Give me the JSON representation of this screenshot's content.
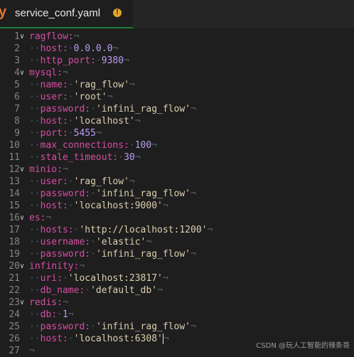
{
  "tab": {
    "file_icon": "y",
    "filename": "service_conf.yaml",
    "warning_icon": "!",
    "accent": "#1f7a3c"
  },
  "editor": {
    "lines": [
      {
        "num": "1",
        "fold": "down",
        "indent": "",
        "key": "ragflow",
        "value": "",
        "vtype": ""
      },
      {
        "num": "2",
        "fold": "",
        "indent": "··",
        "key": "host",
        "value": "0.0.0.0",
        "vtype": "n"
      },
      {
        "num": "3",
        "fold": "",
        "indent": "··",
        "key": "http_port",
        "value": "9380",
        "vtype": "n"
      },
      {
        "num": "4",
        "fold": "down",
        "indent": "",
        "key": "mysql",
        "value": "",
        "vtype": ""
      },
      {
        "num": "5",
        "fold": "",
        "indent": "··",
        "key": "name",
        "value": "'rag_flow'",
        "vtype": "s"
      },
      {
        "num": "6",
        "fold": "",
        "indent": "··",
        "key": "user",
        "value": "'root'",
        "vtype": "s"
      },
      {
        "num": "7",
        "fold": "",
        "indent": "··",
        "key": "password",
        "value": "'infini_rag_flow'",
        "vtype": "s"
      },
      {
        "num": "8",
        "fold": "",
        "indent": "··",
        "key": "host",
        "value": "'localhost'",
        "vtype": "s"
      },
      {
        "num": "9",
        "fold": "",
        "indent": "··",
        "key": "port",
        "value": "5455",
        "vtype": "n"
      },
      {
        "num": "10",
        "fold": "",
        "indent": "··",
        "key": "max_connections",
        "value": "100",
        "vtype": "n"
      },
      {
        "num": "11",
        "fold": "",
        "indent": "··",
        "key": "stale_timeout",
        "value": "30",
        "vtype": "n"
      },
      {
        "num": "12",
        "fold": "down",
        "indent": "",
        "key": "minio",
        "value": "",
        "vtype": ""
      },
      {
        "num": "13",
        "fold": "",
        "indent": "··",
        "key": "user",
        "value": "'rag_flow'",
        "vtype": "s"
      },
      {
        "num": "14",
        "fold": "",
        "indent": "··",
        "key": "password",
        "value": "'infini_rag_flow'",
        "vtype": "s"
      },
      {
        "num": "15",
        "fold": "",
        "indent": "··",
        "key": "host",
        "value": "'localhost:9000'",
        "vtype": "s"
      },
      {
        "num": "16",
        "fold": "down",
        "indent": "",
        "key": "es",
        "value": "",
        "vtype": ""
      },
      {
        "num": "17",
        "fold": "",
        "indent": "··",
        "key": "hosts",
        "value": "'http://localhost:1200'",
        "vtype": "s"
      },
      {
        "num": "18",
        "fold": "",
        "indent": "··",
        "key": "username",
        "value": "'elastic'",
        "vtype": "s"
      },
      {
        "num": "19",
        "fold": "",
        "indent": "··",
        "key": "password",
        "value": "'infini_rag_flow'",
        "vtype": "s"
      },
      {
        "num": "20",
        "fold": "down",
        "indent": "",
        "key": "infinity",
        "value": "",
        "vtype": ""
      },
      {
        "num": "21",
        "fold": "",
        "indent": "··",
        "key": "uri",
        "value": "'localhost:23817'",
        "vtype": "s"
      },
      {
        "num": "22",
        "fold": "",
        "indent": "··",
        "key": "db_name",
        "value": "'default_db'",
        "vtype": "s"
      },
      {
        "num": "23",
        "fold": "down",
        "indent": "",
        "key": "redis",
        "value": "",
        "vtype": ""
      },
      {
        "num": "24",
        "fold": "",
        "indent": "··",
        "key": "db",
        "value": "1",
        "vtype": "n"
      },
      {
        "num": "25",
        "fold": "",
        "indent": "··",
        "key": "password",
        "value": "'infini_rag_flow'",
        "vtype": "s"
      },
      {
        "num": "26",
        "fold": "",
        "indent": "··",
        "key": "host",
        "value": "'localhost:6308'",
        "vtype": "s",
        "cursor": true
      },
      {
        "num": "27",
        "fold": "",
        "indent": "",
        "key": "",
        "value": "",
        "vtype": ""
      }
    ],
    "newline_glyph": "¬",
    "colon": ":",
    "space_glyph": "·"
  },
  "watermark": "CSDN @玩人工智能的辣条哥"
}
